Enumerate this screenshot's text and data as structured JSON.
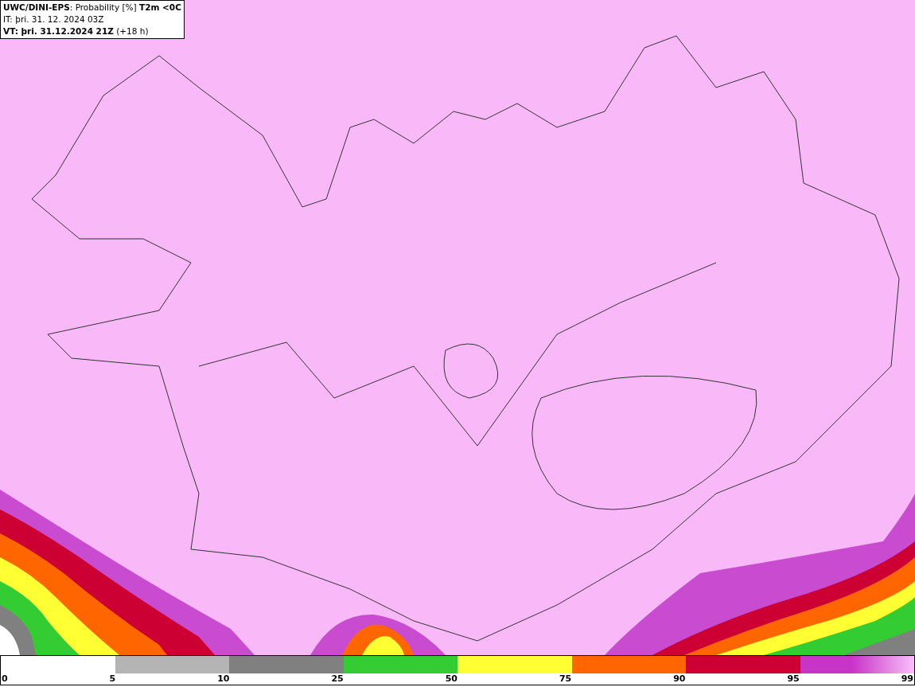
{
  "title_box": {
    "lines": [
      "**UWC/DINI-EPS**: Probability [%] **T2m <0C**",
      "IT: þri. 31. 12. 2024 03Z",
      "**VT: þri. 31.12.2024 21Z** (+18 h)"
    ]
  },
  "colorbar": {
    "segments": [
      {
        "color": "#b4b4b4"
      },
      {
        "color": "#808080"
      },
      {
        "color": "#33cc33"
      },
      {
        "color": "#ffff33"
      },
      {
        "color": "#ff6600"
      },
      {
        "color": "#cc0033"
      },
      {
        "color": "#c833c8"
      }
    ],
    "labels": [
      "0",
      "5",
      "10",
      "25",
      "50",
      "75",
      "90",
      "95",
      "99"
    ]
  }
}
